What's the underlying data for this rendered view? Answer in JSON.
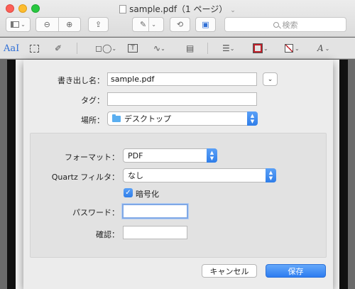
{
  "window": {
    "title": "sample.pdf（1 ページ）",
    "search_placeholder": "検索"
  },
  "toolbar": {
    "markup_text_tool": "AaI"
  },
  "dialog": {
    "export_as_label": "書き出し名：",
    "export_as_value": "sample.pdf",
    "tags_label": "タグ：",
    "tags_value": "",
    "where_label": "場所：",
    "where_value": "デスクトップ",
    "format_label": "フォーマット：",
    "format_value": "PDF",
    "quartz_label": "Quartz フィルタ：",
    "quartz_value": "なし",
    "encrypt_label": "暗号化",
    "encrypt_checked": true,
    "password_label": "パスワード：",
    "password_value": "",
    "verify_label": "確認：",
    "verify_value": "",
    "cancel_button": "キャンセル",
    "save_button": "保存"
  },
  "colors": {
    "accent": "#2f7ee9",
    "close": "#fc5f57",
    "minimize": "#fdbc2e",
    "maximize": "#28c840"
  }
}
